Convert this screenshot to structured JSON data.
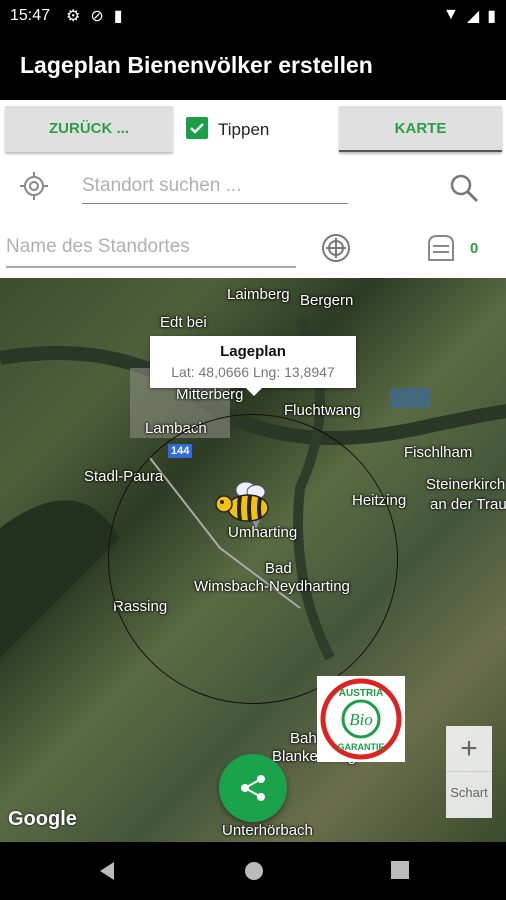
{
  "status_bar": {
    "time": "15:47"
  },
  "app_bar": {
    "title": "Lageplan Bienenvölker erstellen"
  },
  "toolbar": {
    "back_label": "ZURÜCK ...",
    "checkbox_label": "Tippen",
    "map_label": "KARTE",
    "checkbox_checked": true
  },
  "search": {
    "placeholder": "Standort suchen ..."
  },
  "location": {
    "name_placeholder": "Name des Standortes",
    "hive_count": "0"
  },
  "map": {
    "info_title": "Lageplan",
    "info_coords": "Lat: 48,0666 Lng: 13,8947",
    "road_label": "144",
    "places": [
      "Laimberg",
      "Bergern",
      "Edt bei",
      "Mitterberg",
      "Fluchtwang",
      "Lambach",
      "Fischlham",
      "Stadl-Paura",
      "Steinerkirch",
      "an der Trau",
      "Heitzing",
      "Umharting",
      "Bad",
      "Wimsbach-Neydharting",
      "Rassing",
      "Bahnhof",
      "Blankenberg",
      "Unterhörbach"
    ],
    "logo_text": "Google",
    "zoom_in": "+",
    "scale_text": "Schart"
  },
  "badge": {
    "top": "AUSTRIA",
    "center": "Bio",
    "bottom": "GARANTIE"
  },
  "colors": {
    "accent": "#2e9e45",
    "fab": "#1aa34a",
    "circle": "#111111"
  }
}
